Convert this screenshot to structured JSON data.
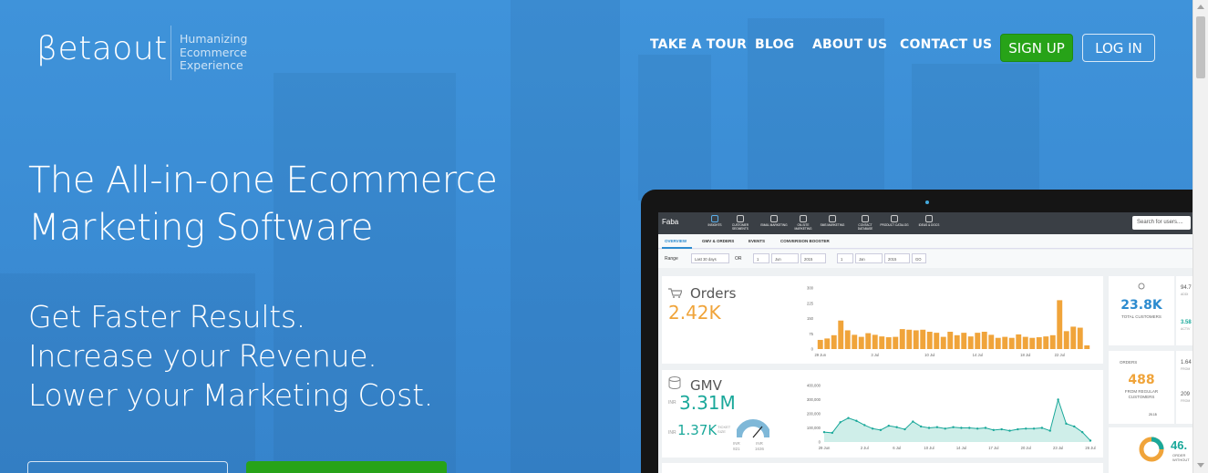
{
  "header": {
    "logo": "βetaout",
    "tagline": [
      "Humanizing",
      "Ecommerce",
      "Experience"
    ],
    "nav": [
      "TAKE A TOUR",
      "BLOG",
      "ABOUT US",
      "CONTACT US"
    ],
    "signup": "SIGN UP",
    "login": "LOG IN"
  },
  "hero": {
    "headline": [
      "The All-in-one Ecommerce",
      "Marketing Software"
    ],
    "sublines": [
      "Get Faster Results.",
      "Increase your Revenue.",
      "Lower your Marketing Cost."
    ]
  },
  "app": {
    "name": "Faba",
    "icons": [
      "INSIGHTS",
      "CUSTOMER SEGMENTS",
      "EMAIL MARKETING",
      "ON-SITE MARKETING",
      "SMS MARKETING",
      "CONTACT DATABASE",
      "PRODUCT CATALOG",
      "IDEAS & DOCS"
    ],
    "search_placeholder": "Search for users....",
    "tabs": [
      "OVERVIEW",
      "GMV & ORDERS",
      "EVENTS",
      "CONVERSION BOOSTER"
    ],
    "filter": {
      "range_label": "Range",
      "range_value": "Last 30 days",
      "or": "OR",
      "d1": "1",
      "m1": "Jun",
      "y1": "2015",
      "d2": "1",
      "m2": "Jan",
      "y2": "2015",
      "go": "GO"
    },
    "orders": {
      "title": "Orders",
      "value": "2.42K"
    },
    "gmv": {
      "title": "GMV",
      "currency": "INR",
      "value": "3.31M",
      "ticket_currency": "INR",
      "ticket_value": "1.37K",
      "ticket_label": "TICKET SIZE",
      "gauge_min_cur": "INR",
      "gauge_min": "821",
      "gauge_max_cur": "INR",
      "gauge_max": "1636"
    },
    "right": {
      "customers_value": "23.8K",
      "customers_label": "TOTAL CUSTOMERS",
      "r1": "94.7",
      "r1s": "ADDI",
      "r2": "3.58",
      "r2s": "ACTIV",
      "orders_label": "ORDERS",
      "orders_value": "488",
      "orders_sub": "FROM REGULAR CUSTOMERS",
      "r3": "1.64",
      "r3s": "FROM",
      "r4": "209",
      "r4s": "FROM",
      "pct": "20.15",
      "donut_value": "46.",
      "donut_sub": "ORDER WITHOUT"
    }
  },
  "chart_data": [
    {
      "type": "bar",
      "title": "Orders",
      "x": [
        "29 Jun",
        "",
        "",
        "",
        "",
        "",
        "",
        "",
        "3 Jul",
        "",
        "",
        "",
        "",
        "",
        "",
        "",
        "10 Jul",
        "",
        "",
        "",
        "",
        "",
        "",
        "14 Jul",
        "",
        "",
        "",
        "",
        "",
        "",
        "18 Jul",
        "",
        "",
        "",
        "",
        "22 Jul",
        "",
        "",
        "",
        "",
        "25 Jul"
      ],
      "yticks": [
        "300",
        "225",
        "150",
        "75",
        "0"
      ],
      "ylim": [
        0,
        300
      ],
      "values": [
        45,
        52,
        68,
        140,
        92,
        70,
        60,
        78,
        70,
        62,
        58,
        60,
        98,
        95,
        92,
        95,
        85,
        80,
        60,
        85,
        68,
        80,
        62,
        80,
        85,
        70,
        55,
        60,
        55,
        72,
        60,
        55,
        58,
        62,
        68,
        240,
        88,
        110,
        105,
        18
      ]
    },
    {
      "type": "area",
      "title": "GMV",
      "x": [
        "29 Jun",
        "",
        "",
        "",
        "",
        "2 Jul",
        "",
        "",
        "",
        "6 Jul",
        "",
        "",
        "",
        "10 Jul",
        "",
        "",
        "",
        "14 Jul",
        "",
        "",
        "",
        "17 Jul",
        "",
        "",
        "",
        "20 Jul",
        "",
        "",
        "",
        "23 Jul",
        "",
        "",
        "",
        "26 Jul"
      ],
      "yticks": [
        "400,000",
        "300,000",
        "200,000",
        "100,000",
        "0"
      ],
      "ylim": [
        0,
        400000
      ],
      "values": [
        70000,
        65000,
        140000,
        170000,
        150000,
        120000,
        95000,
        85000,
        115000,
        105000,
        90000,
        145000,
        110000,
        100000,
        105000,
        95000,
        105000,
        100000,
        100000,
        95000,
        100000,
        85000,
        90000,
        80000,
        90000,
        95000,
        95000,
        100000,
        80000,
        300000,
        130000,
        110000,
        70000,
        10000
      ]
    }
  ],
  "colors": {
    "hero_bg": "#3d8fd6",
    "signup_green": "#27a318",
    "orders_orange": "#f0a43a",
    "gmv_teal": "#1aa89a"
  }
}
